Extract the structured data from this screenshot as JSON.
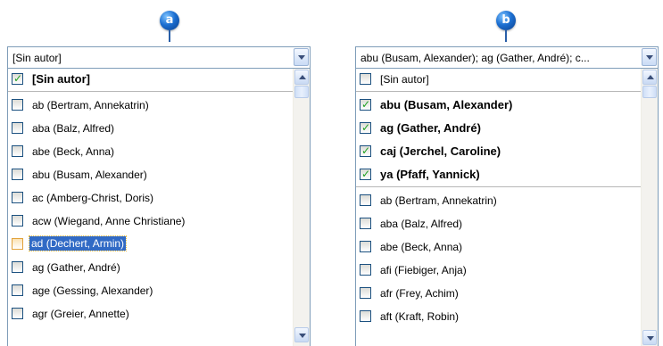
{
  "callouts": {
    "a": "a",
    "b": "b"
  },
  "panel_a": {
    "combo_value": "[Sin autor]",
    "items": [
      {
        "label": "[Sin autor]",
        "checked": true,
        "bold": true
      },
      {
        "label": "ab (Bertram, Annekatrin)",
        "checked": false
      },
      {
        "label": "aba (Balz, Alfred)",
        "checked": false
      },
      {
        "label": "abe (Beck, Anna)",
        "checked": false
      },
      {
        "label": "abu (Busam, Alexander)",
        "checked": false
      },
      {
        "label": "ac (Amberg-Christ, Doris)",
        "checked": false
      },
      {
        "label": "acw (Wiegand, Anne Christiane)",
        "checked": false
      },
      {
        "label_code": "ad",
        "label_rest": " (Dechert, Armin)",
        "checked": false,
        "selected": true
      },
      {
        "label": "ag (Gather, André)",
        "checked": false
      },
      {
        "label": "age (Gessing, Alexander)",
        "checked": false
      },
      {
        "label": "agr (Greier, Annette)",
        "checked": false
      }
    ]
  },
  "panel_b": {
    "combo_value": "abu (Busam, Alexander); ag (Gather, André); c...",
    "items": [
      {
        "label": "[Sin autor]",
        "checked": false
      },
      {
        "label": "abu (Busam, Alexander)",
        "checked": true,
        "bold": true
      },
      {
        "label": "ag (Gather, André)",
        "checked": true,
        "bold": true
      },
      {
        "label": "caj (Jerchel, Caroline)",
        "checked": true,
        "bold": true
      },
      {
        "label": "ya (Pfaff, Yannick)",
        "checked": true,
        "bold": true
      },
      {
        "label": "ab (Bertram, Annekatrin)",
        "checked": false
      },
      {
        "label": "aba (Balz, Alfred)",
        "checked": false
      },
      {
        "label": "abe (Beck, Anna)",
        "checked": false
      },
      {
        "label": "afi (Fiebiger, Anja)",
        "checked": false
      },
      {
        "label": "afr (Frey, Achim)",
        "checked": false
      },
      {
        "label": "aft (Kraft, Robin)",
        "checked": false
      }
    ]
  },
  "icons": {
    "check": "✓",
    "dropdown": "chevron-down-icon",
    "scroll_up": "chevron-up-icon",
    "scroll_down": "chevron-down-icon"
  }
}
